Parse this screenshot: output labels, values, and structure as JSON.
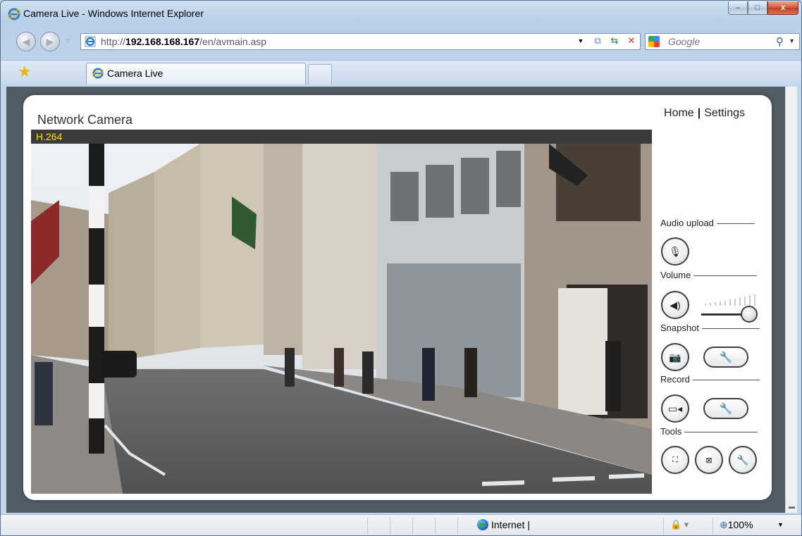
{
  "window": {
    "title": "Camera Live - Windows Internet Explorer",
    "controls": {
      "minimize": "–",
      "maximize": "□",
      "close": "x"
    }
  },
  "navigation": {
    "back_glyph": "◀",
    "forward_glyph": "▶",
    "url_prefix": "http://",
    "url_host": "192.168.168.167",
    "url_path": "/en/avmain.asp",
    "search_placeholder": "Google",
    "icons": [
      "ie-icon",
      "dropdown-icon",
      "compat-view-icon",
      "refresh-icon",
      "stop-icon",
      "google-icon",
      "search-icon"
    ]
  },
  "tabs": [
    {
      "label": "Camera Live",
      "active": true
    }
  ],
  "page": {
    "title": "Network Camera",
    "links": {
      "home": "Home",
      "separator": "|",
      "settings": "Settings"
    },
    "codec": "H.264",
    "controls": {
      "audio_upload": "Audio upload",
      "volume": "Volume",
      "volume_level": 1.0,
      "snapshot": "Snapshot",
      "record": "Record",
      "tools": "Tools"
    }
  },
  "status_bar": {
    "zone": "Internet |",
    "zoom": "100%"
  },
  "colors": {
    "codec_text": "#ffe400",
    "viewport_bg": "#525c64",
    "frame": "#b9d1ea"
  }
}
